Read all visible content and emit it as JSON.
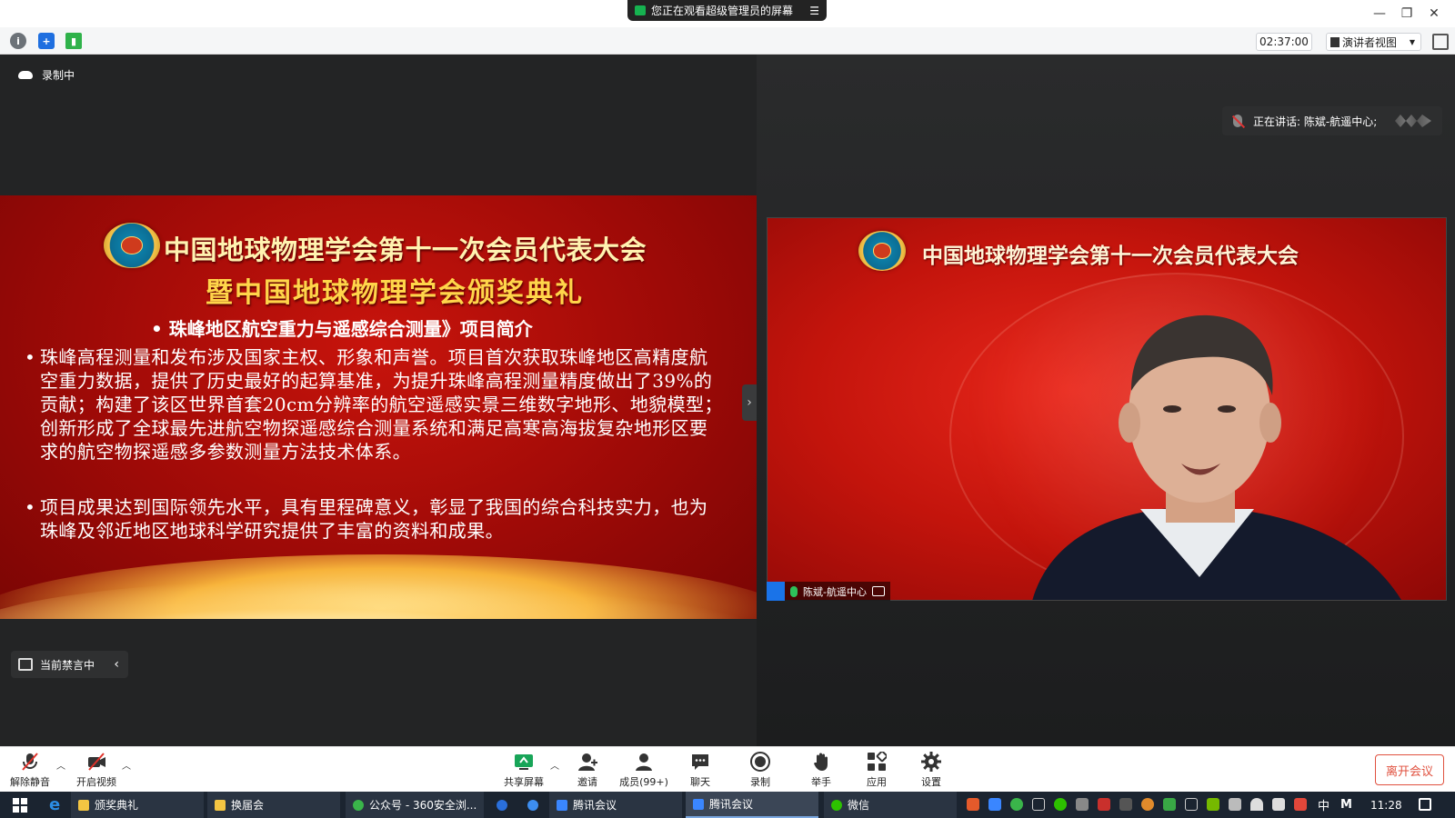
{
  "window": {
    "share_banner": "您正在观看超级管理员的屏幕",
    "share_menu_icon": "list-icon",
    "controls": [
      "minimize-icon",
      "restore-icon",
      "close-icon"
    ]
  },
  "toolbar": {
    "timer": "02:37:00",
    "view_mode": "演讲者视图",
    "icons": [
      "info-icon",
      "shield-icon",
      "signal-icon",
      "fullscreen-icon"
    ]
  },
  "stage": {
    "recording_label": "录制中",
    "mute_notice": "当前禁言中"
  },
  "slide": {
    "title": "中国地球物理学会第十一次会员代表大会",
    "subtitle": "暨中国地球物理学会颁奖典礼",
    "heading": "• 珠峰地区航空重力与遥感综合测量》项目简介",
    "bullet": "•",
    "paragraph1": "珠峰高程测量和发布涉及国家主权、形象和声誉。项目首次获取珠峰地区高精度航空重力数据，提供了历史最好的起算基准，为提升珠峰高程测量精度做出了39%的贡献；构建了该区世界首套20cm分辨率的航空遥感实景三维数字地形、地貌模型；创新形成了全球最先进航空物探遥感综合测量系统和满足高寒高海拔复杂地形区要求的航空物探遥感多参数测量方法技术体系。",
    "paragraph2": "项目成果达到国际领先水平，具有里程碑意义，彰显了我国的综合科技实力，也为珠峰及邻近地区地球科学研究提供了丰富的资料和成果。"
  },
  "speaker": {
    "speaking_label": "正在讲话: 陈斌-航遥中心;",
    "video_title": "中国地球物理学会第十一次会员代表大会",
    "name_tag": "陈斌-航遥中心"
  },
  "controls": {
    "unmute": "解除静音",
    "video": "开启视频",
    "share": "共享屏幕",
    "invite": "邀请",
    "members": "成员(99+)",
    "chat": "聊天",
    "record": "录制",
    "raise_hand": "举手",
    "apps": "应用",
    "settings": "设置",
    "leave": "离开会议"
  },
  "taskbar": {
    "items": [
      "颁奖典礼",
      "换届会",
      "公众号 - 360安全浏...",
      "腾讯会议",
      "腾讯会议",
      "微信"
    ],
    "ime_lang": "中",
    "ime_mode": "M",
    "clock": "11:28"
  },
  "colors": {
    "accent_red": "#e0513f",
    "slide_red": "#b50e09",
    "gold": "#ffd54a",
    "taskbar": "#1b2430"
  }
}
